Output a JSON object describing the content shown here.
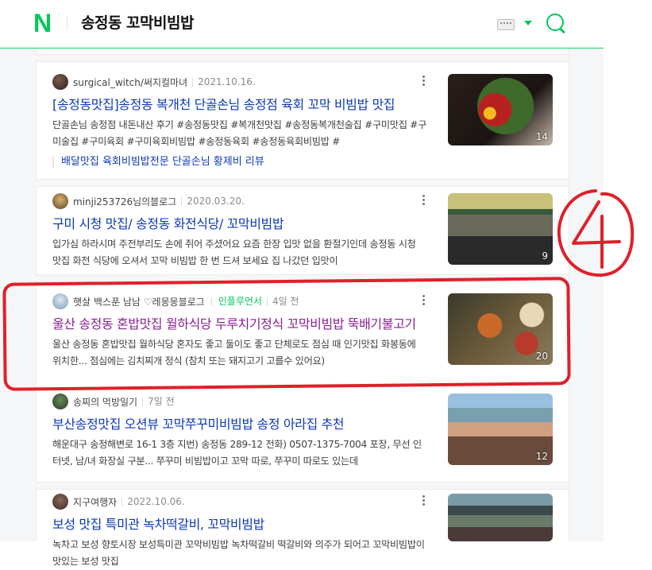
{
  "header": {
    "logo": "N",
    "query": "송정동 꼬막비빔밥",
    "icons": {
      "keyboard": "keyboard-icon",
      "dropdown": "caret-down-icon",
      "search": "search-icon"
    },
    "accent_color": "#03c75a"
  },
  "results": [
    {
      "author": "surgical_witch/써지컬마녀",
      "date": "2021.10.16.",
      "title": "[송정동맛집]송정동 복개천 단골손님 송정점 육회 꼬막 비빔밥 맛집",
      "desc": "단골손님 송정점 내돈내산 후기 #송정동맛집 #복개천맛집 #송정동복개천술집 #구미맛집 #구미술집 #구미육회 #구미육회비빔밥 #송정동육회 #송정동육회비빔밥 #",
      "sub": "배달맛집 육회비빔밥전문 단골손님 황제비 리뷰",
      "count": "14"
    },
    {
      "author": "minji253726님의블로그",
      "date": "2020.03.20.",
      "title": "구미 시청 맛집/ 송정동 화전식당/ 꼬막비빔밥",
      "desc": "입가심 하라시며 주전부리도 손에 쥐어 주셨어요 요즘 한장 입맛 없을 환절기인데 송정동 시청 맛집 화전 식당에 오셔서 꼬막 비빔밥 한 번 드셔 보세요 집 나갔던 입맛이",
      "count": "9"
    },
    {
      "author": "햇살 백스푼 남남 ♡레몽몽블로그",
      "badge": "인플루언서",
      "date": "4일 전",
      "title": "울산 송정동 혼밥맛집 월하식당 두루치기정식 꼬막비빔밥 뚝배기불고기",
      "desc": "울산 송정동 혼밥맛집 월하식당 혼자도 좋고 둘이도 좋고 단체로도 점심 때 인기맛집 화봉동에 위치한... 점심에는 김치찌개 정식 (참치 또는 돼지고기 고를수 있어요)",
      "count": "20"
    },
    {
      "author": "송찌의 먹방일기",
      "date": "7일 전",
      "title": "부산송정맛집 오션뷰 꼬막쭈꾸미비빔밥 송정 아라집 추천",
      "desc": "해운대구 송정해변로 16-1 3층 지번) 송정동 289-12 전화) 0507-1375-7004 포장, 무선 인터넷, 남/녀 화장실 구분... 쭈꾸미 비빔밥이고 꼬막 따로, 쭈꾸미 따로도 있는데",
      "count": "12"
    },
    {
      "author": "지구여행자",
      "date": "2022.10.06.",
      "title": "보성 맛집 특미관 녹차떡갈비, 꼬막비빔밥",
      "desc": "녹차고 보성 향토시장 보성특미관 꼬막비빔밥 녹차떡갈비 떡갈비와 의주가 되어고 꼬막비빔밥이 맛있는 보성 맛집",
      "count": ""
    }
  ],
  "annotation": {
    "label": "4",
    "color": "#e0202a"
  }
}
